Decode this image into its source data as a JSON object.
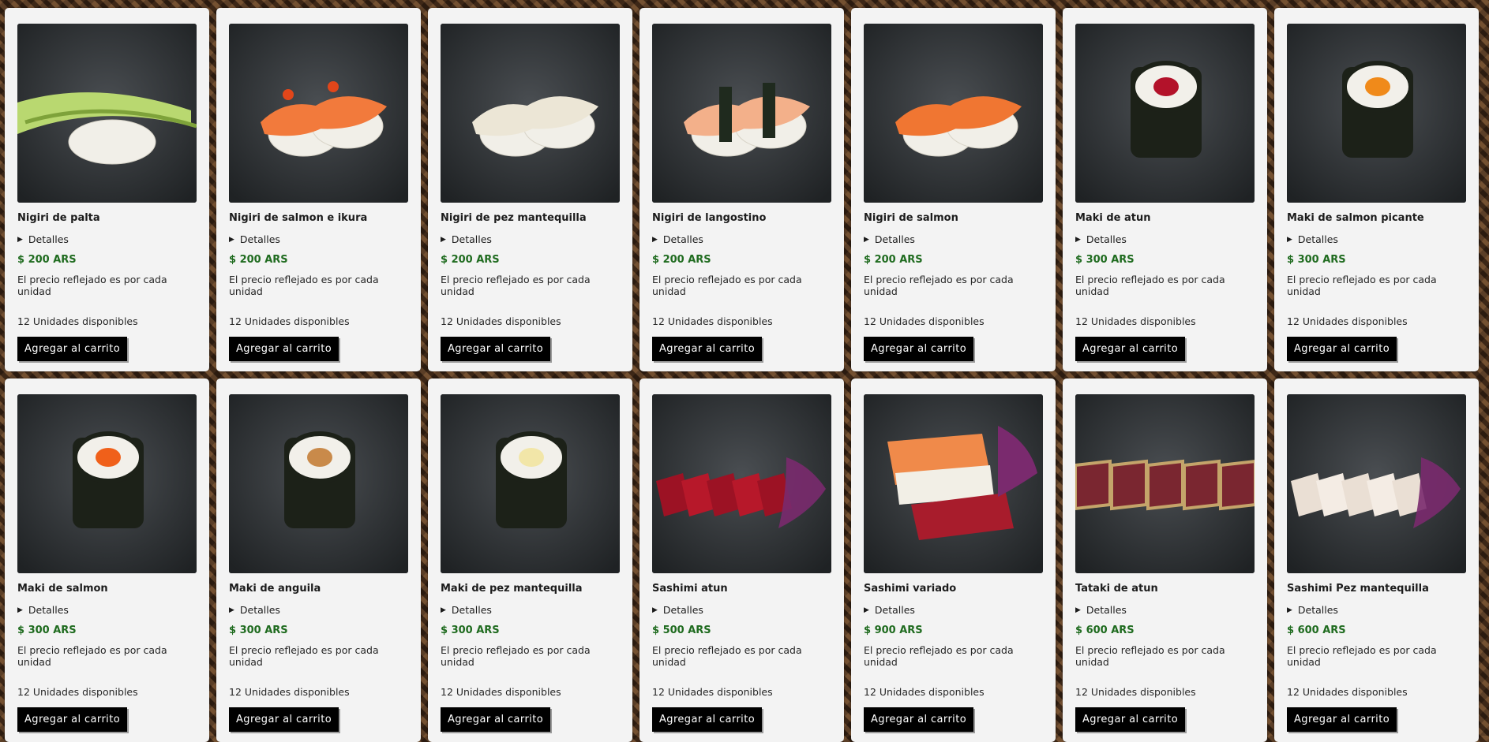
{
  "ui": {
    "details_label": "Detalles",
    "details_icon": "triangle-right-icon",
    "price_note": "El precio reflejado es por cada unidad",
    "add_to_cart": "Agregar al carrito",
    "price_color": "#1f6b1f"
  },
  "products": [
    {
      "name": "Nigiri de palta",
      "price": "$ 200 ARS",
      "stock": "12 Unidades disponibles",
      "image": "nigiri-palta"
    },
    {
      "name": "Nigiri de salmon e ikura",
      "price": "$ 200 ARS",
      "stock": "12 Unidades disponibles",
      "image": "nigiri-salmon-ikura"
    },
    {
      "name": "Nigiri de pez mantequilla",
      "price": "$ 200 ARS",
      "stock": "12 Unidades disponibles",
      "image": "nigiri-pez-mantequilla"
    },
    {
      "name": "Nigiri de langostino",
      "price": "$ 200 ARS",
      "stock": "12 Unidades disponibles",
      "image": "nigiri-langostino"
    },
    {
      "name": "Nigiri de salmon",
      "price": "$ 200 ARS",
      "stock": "12 Unidades disponibles",
      "image": "nigiri-salmon"
    },
    {
      "name": "Maki de atun",
      "price": "$ 300 ARS",
      "stock": "12 Unidades disponibles",
      "image": "maki-atun"
    },
    {
      "name": "Maki de salmon picante",
      "price": "$ 300 ARS",
      "stock": "12 Unidades disponibles",
      "image": "maki-salmon-picante"
    },
    {
      "name": "Maki de salmon",
      "price": "$ 300 ARS",
      "stock": "12 Unidades disponibles",
      "image": "maki-salmon"
    },
    {
      "name": "Maki de anguila",
      "price": "$ 300 ARS",
      "stock": "12 Unidades disponibles",
      "image": "maki-anguila"
    },
    {
      "name": "Maki de pez mantequilla",
      "price": "$ 300 ARS",
      "stock": "12 Unidades disponibles",
      "image": "maki-pez-mantequilla"
    },
    {
      "name": "Sashimi atun",
      "price": "$ 500 ARS",
      "stock": "12 Unidades disponibles",
      "image": "sashimi-atun"
    },
    {
      "name": "Sashimi variado",
      "price": "$ 900 ARS",
      "stock": "12 Unidades disponibles",
      "image": "sashimi-variado"
    },
    {
      "name": "Tataki de atun",
      "price": "$ 600 ARS",
      "stock": "12 Unidades disponibles",
      "image": "tataki-atun"
    },
    {
      "name": "Sashimi Pez mantequilla",
      "price": "$ 600 ARS",
      "stock": "12 Unidades disponibles",
      "image": "sashimi-pez-mantequilla"
    }
  ]
}
